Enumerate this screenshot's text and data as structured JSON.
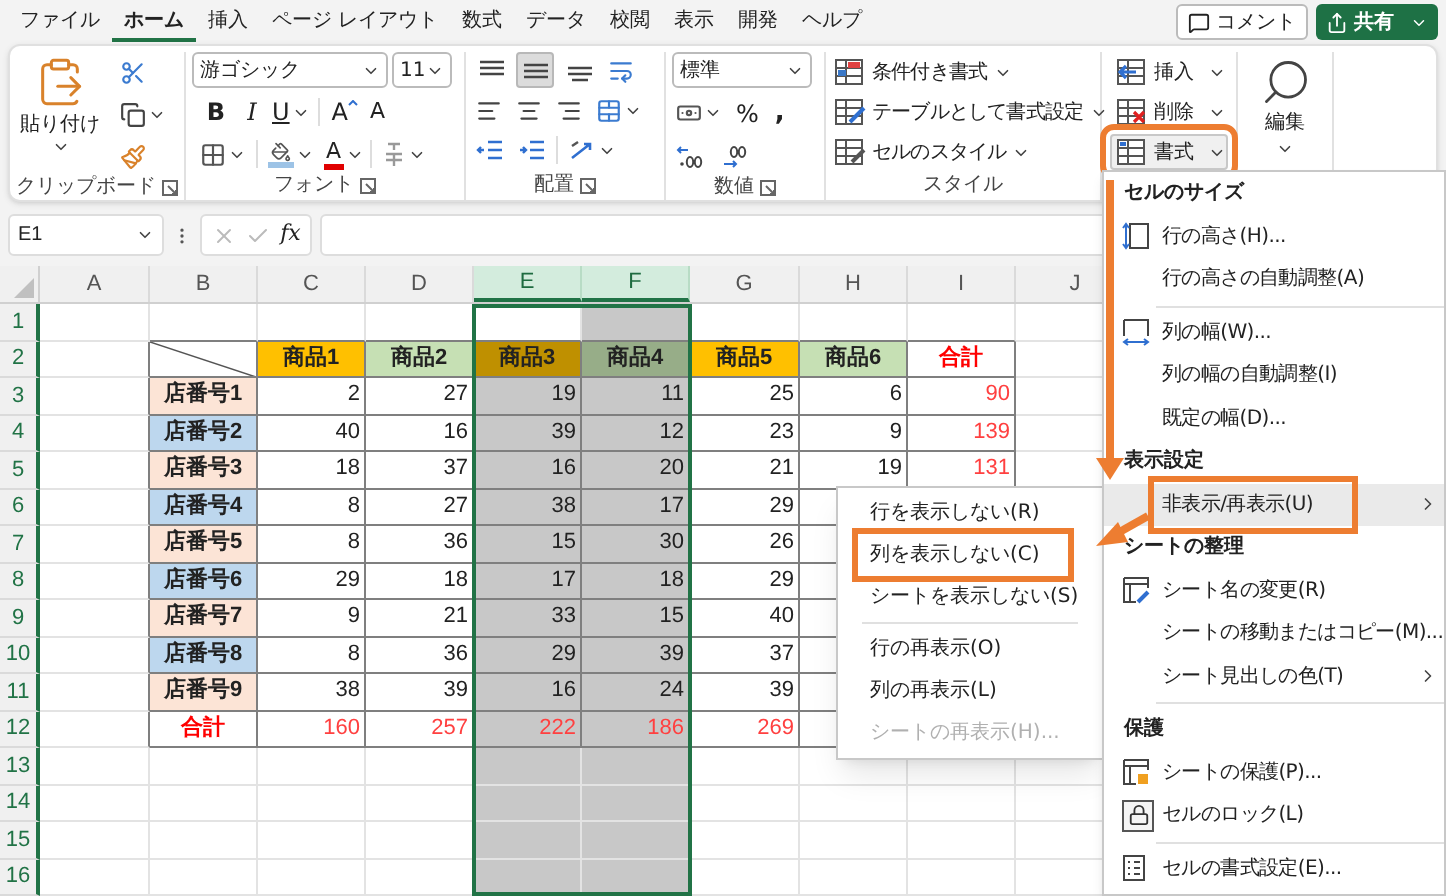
{
  "tabs": [
    {
      "label": "ファイル",
      "selected": false
    },
    {
      "label": "ホーム",
      "selected": true
    },
    {
      "label": "挿入",
      "selected": false
    },
    {
      "label": "ページ レイアウト",
      "selected": false
    },
    {
      "label": "数式",
      "selected": false
    },
    {
      "label": "データ",
      "selected": false
    },
    {
      "label": "校閲",
      "selected": false
    },
    {
      "label": "表示",
      "selected": false
    },
    {
      "label": "開発",
      "selected": false
    },
    {
      "label": "ヘルプ",
      "selected": false
    }
  ],
  "comment_button": "コメント",
  "share_button": "共有",
  "ribbon": {
    "clipboard": {
      "paste": "貼り付け",
      "label": "クリップボード"
    },
    "font": {
      "name": "游ゴシック",
      "size": "11",
      "bold": "B",
      "italic": "I",
      "underline": "U",
      "grow": "A",
      "shrink": "A",
      "font_color_glyph": "A",
      "label": "フォント"
    },
    "alignment": {
      "vertical_align": [
        {
          "selected": false
        },
        {
          "selected": true
        },
        {
          "selected": false
        }
      ],
      "label": "配置"
    },
    "number": {
      "format": "標準",
      "percent": "%",
      "comma": ",",
      "label": "数値"
    },
    "styles": {
      "buttons": [
        "条件付き書式",
        "テーブルとして書式設定",
        "セルのスタイル"
      ],
      "label": "スタイル"
    },
    "cells": {
      "buttons": [
        {
          "label": "挿入",
          "highlighted": false
        },
        {
          "label": "削除",
          "highlighted": false
        },
        {
          "label": "書式",
          "highlighted": true
        }
      ]
    },
    "editing": {
      "label": "編集"
    }
  },
  "formula_bar": {
    "name_box": "E1",
    "function_label": "fx"
  },
  "sheet": {
    "columns": [
      {
        "label": "A",
        "selected": false
      },
      {
        "label": "B",
        "selected": false
      },
      {
        "label": "C",
        "selected": false
      },
      {
        "label": "D",
        "selected": false
      },
      {
        "label": "E",
        "selected": true
      },
      {
        "label": "F",
        "selected": true
      },
      {
        "label": "G",
        "selected": false
      },
      {
        "label": "H",
        "selected": false
      },
      {
        "label": "I",
        "selected": false
      },
      {
        "label": "J",
        "selected": false
      }
    ],
    "row_numbers": [
      "1",
      "2",
      "3",
      "4",
      "5",
      "6",
      "7",
      "8",
      "9",
      "10",
      "11",
      "12",
      "13",
      "14",
      "15",
      "16"
    ],
    "table": {
      "headers": [
        {
          "text": "商品1",
          "color": "#ffc000"
        },
        {
          "text": "商品2",
          "color": "#c6e0b4"
        },
        {
          "text": "商品3",
          "color": "#bf9000"
        },
        {
          "text": "商品4",
          "color": "#97ad88"
        },
        {
          "text": "商品5",
          "color": "#ffc000"
        },
        {
          "text": "商品6",
          "color": "#c6e0b4"
        }
      ],
      "total_header": "合計",
      "rows": [
        {
          "label": "店番号1",
          "color": "#fce4d6",
          "values": [
            "2",
            "27",
            "19",
            "11",
            "25",
            "6",
            "90"
          ]
        },
        {
          "label": "店番号2",
          "color": "#bdd7ee",
          "values": [
            "40",
            "16",
            "39",
            "12",
            "23",
            "9",
            "139"
          ]
        },
        {
          "label": "店番号3",
          "color": "#fce4d6",
          "values": [
            "18",
            "37",
            "16",
            "20",
            "21",
            "19",
            "131"
          ]
        },
        {
          "label": "店番号4",
          "color": "#bdd7ee",
          "values": [
            "8",
            "27",
            "38",
            "17",
            "29"
          ]
        },
        {
          "label": "店番号5",
          "color": "#fce4d6",
          "values": [
            "8",
            "36",
            "15",
            "30",
            "26"
          ]
        },
        {
          "label": "店番号6",
          "color": "#bdd7ee",
          "values": [
            "29",
            "18",
            "17",
            "18",
            "29"
          ]
        },
        {
          "label": "店番号7",
          "color": "#fce4d6",
          "values": [
            "9",
            "21",
            "33",
            "15",
            "40"
          ]
        },
        {
          "label": "店番号8",
          "color": "#bdd7ee",
          "values": [
            "8",
            "36",
            "29",
            "39",
            "37"
          ]
        },
        {
          "label": "店番号9",
          "color": "#fce4d6",
          "values": [
            "38",
            "39",
            "16",
            "24",
            "39"
          ]
        }
      ],
      "total_row": {
        "label": "合計",
        "values": [
          "160",
          "257",
          "222",
          "186",
          "269"
        ]
      }
    }
  },
  "format_menu": {
    "items": [
      {
        "kind": "heading",
        "label": "セルのサイズ"
      },
      {
        "kind": "item",
        "label": "行の高さ(H)...",
        "selected": false,
        "has_submenu": false,
        "highlighted": false
      },
      {
        "kind": "item",
        "label": "行の高さの自動調整(A)",
        "selected": false,
        "has_submenu": false,
        "highlighted": false
      },
      {
        "kind": "separator"
      },
      {
        "kind": "item",
        "label": "列の幅(W)...",
        "selected": false,
        "has_submenu": false,
        "highlighted": false
      },
      {
        "kind": "item",
        "label": "列の幅の自動調整(I)",
        "selected": false,
        "has_submenu": false,
        "highlighted": false
      },
      {
        "kind": "item",
        "label": "既定の幅(D)...",
        "selected": false,
        "has_submenu": false,
        "highlighted": false
      },
      {
        "kind": "heading",
        "label": "表示設定"
      },
      {
        "kind": "item",
        "label": "非表示/再表示(U)",
        "selected": true,
        "has_submenu": true,
        "highlighted": true
      },
      {
        "kind": "heading",
        "label": "シートの整理"
      },
      {
        "kind": "item",
        "label": "シート名の変更(R)",
        "selected": false,
        "has_submenu": false,
        "highlighted": false
      },
      {
        "kind": "item",
        "label": "シートの移動またはコピー(M)...",
        "selected": false,
        "has_submenu": false,
        "highlighted": false
      },
      {
        "kind": "item",
        "label": "シート見出しの色(T)",
        "selected": false,
        "has_submenu": true,
        "highlighted": false
      },
      {
        "kind": "separator"
      },
      {
        "kind": "heading",
        "label": "保護"
      },
      {
        "kind": "item",
        "label": "シートの保護(P)...",
        "selected": false,
        "has_submenu": false,
        "highlighted": false
      },
      {
        "kind": "item",
        "label": "セルのロック(L)",
        "selected": false,
        "has_submenu": false,
        "highlighted": false
      },
      {
        "kind": "separator"
      },
      {
        "kind": "item",
        "label": "セルの書式設定(E)...",
        "selected": false,
        "has_submenu": false,
        "highlighted": false
      }
    ]
  },
  "hide_submenu": {
    "items": [
      {
        "kind": "item",
        "label": "行を表示しない(R)",
        "disabled": false,
        "highlighted": false
      },
      {
        "kind": "item",
        "label": "列を表示しない(C)",
        "disabled": false,
        "highlighted": true
      },
      {
        "kind": "item",
        "label": "シートを表示しない(S)",
        "disabled": false,
        "highlighted": false
      },
      {
        "kind": "separator"
      },
      {
        "kind": "item",
        "label": "行の再表示(O)",
        "disabled": false,
        "highlighted": false
      },
      {
        "kind": "item",
        "label": "列の再表示(L)",
        "disabled": false,
        "highlighted": false
      },
      {
        "kind": "item",
        "label": "シートの再表示(H)...",
        "disabled": true,
        "highlighted": false
      }
    ]
  }
}
